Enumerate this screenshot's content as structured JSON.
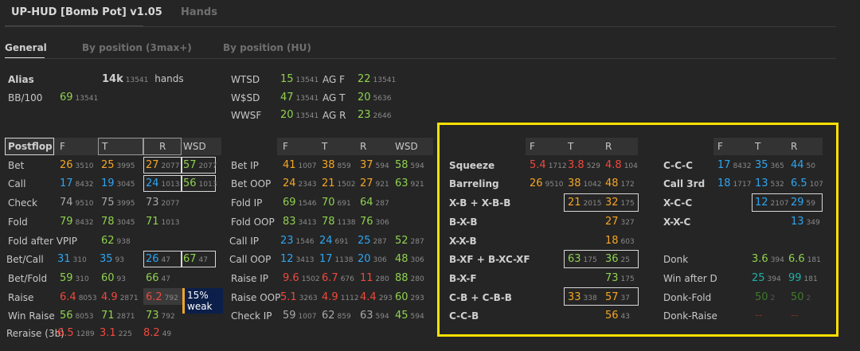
{
  "tabs_top": {
    "active": "UP-HUD [Bomb Pot] v1.05",
    "other": "Hands"
  },
  "tabs_sub": {
    "general": "General",
    "by_pos_3max": "By position (3max+)",
    "by_pos_hu": "By position (HU)"
  },
  "summary": {
    "alias_label": "Alias",
    "hands_val": "14k",
    "hands_n": "13541",
    "hands_label": "hands",
    "bb100_label": "BB/100",
    "bb100_val": "69",
    "bb100_n": "13541",
    "wtsd_label": "WTSD",
    "wtsd_val": "15",
    "wtsd_n": "13541",
    "wssd_label": "W$SD",
    "wssd_val": "47",
    "wssd_n": "13541",
    "wwsf_label": "WWSF",
    "wwsf_val": "20",
    "wwsf_n": "13541",
    "agf_label": "AG F",
    "agf_val": "22",
    "agf_n": "13541",
    "agt_label": "AG T",
    "agt_val": "20",
    "agt_n": "5636",
    "agr_label": "AG R",
    "agr_val": "23",
    "agr_n": "2646"
  },
  "postflop": {
    "title": "Postflop",
    "cols": [
      "F",
      "T",
      "R",
      "WSD"
    ],
    "rows": [
      {
        "label": "Bet",
        "v": [
          [
            "26",
            "3510"
          ],
          [
            "25",
            "3995"
          ],
          [
            "27",
            "2077"
          ],
          [
            "57",
            "2077"
          ]
        ]
      },
      {
        "label": "Call",
        "v": [
          [
            "17",
            "8432"
          ],
          [
            "19",
            "3045"
          ],
          [
            "24",
            "1013"
          ],
          [
            "56",
            "1013"
          ]
        ]
      },
      {
        "label": "Check",
        "v": [
          [
            "74",
            "9510"
          ],
          [
            "75",
            "3995"
          ],
          [
            "73",
            "2077"
          ]
        ]
      },
      {
        "label": "Fold",
        "v": [
          [
            "79",
            "8432"
          ],
          [
            "78",
            "3045"
          ],
          [
            "71",
            "1013"
          ]
        ]
      },
      {
        "label": "Fold after VPIP",
        "v": [
          [
            "62",
            "938"
          ]
        ]
      },
      {
        "label": "Bet/Call",
        "v": [
          [
            "31",
            "310"
          ],
          [
            "35",
            "93"
          ],
          [
            "26",
            "47"
          ],
          [
            "67",
            "47"
          ]
        ]
      },
      {
        "label": "Bet/Fold",
        "v": [
          [
            "59",
            "310"
          ],
          [
            "60",
            "93"
          ],
          [
            "66",
            "47"
          ]
        ]
      },
      {
        "label": "Raise",
        "v": [
          [
            "6.4",
            "8053"
          ],
          [
            "4.9",
            "2871"
          ],
          [
            "6.2",
            "792"
          ]
        ]
      },
      {
        "label": "Win Raise",
        "v": [
          [
            "56",
            "8053"
          ],
          [
            "71",
            "2871"
          ],
          [
            "73",
            "792"
          ]
        ]
      },
      {
        "label": "Reraise (3b)",
        "v": [
          [
            "6.5",
            "1289"
          ],
          [
            "3.1",
            "225"
          ],
          [
            "8.2",
            "49"
          ]
        ]
      }
    ],
    "tooltip": "15% weak"
  },
  "ipoop": {
    "cols": [
      "F",
      "T",
      "R",
      "WSD"
    ],
    "rows": [
      {
        "label": "Bet IP",
        "v": [
          [
            "41",
            "1007"
          ],
          [
            "38",
            "859"
          ],
          [
            "37",
            "594"
          ],
          [
            "58",
            "594"
          ]
        ]
      },
      {
        "label": "Bet OOP",
        "v": [
          [
            "24",
            "2343"
          ],
          [
            "21",
            "1502"
          ],
          [
            "27",
            "921"
          ],
          [
            "63",
            "921"
          ]
        ]
      },
      {
        "label": "Fold IP",
        "v": [
          [
            "69",
            "1546"
          ],
          [
            "70",
            "691"
          ],
          [
            "64",
            "287"
          ]
        ]
      },
      {
        "label": "Fold OOP",
        "v": [
          [
            "83",
            "3413"
          ],
          [
            "78",
            "1138"
          ],
          [
            "76",
            "306"
          ]
        ]
      },
      {
        "label": "Call IP",
        "v": [
          [
            "23",
            "1546"
          ],
          [
            "24",
            "691"
          ],
          [
            "25",
            "287"
          ],
          [
            "52",
            "287"
          ]
        ]
      },
      {
        "label": "Call OOP",
        "v": [
          [
            "12",
            "3413"
          ],
          [
            "17",
            "1138"
          ],
          [
            "20",
            "306"
          ],
          [
            "48",
            "306"
          ]
        ]
      },
      {
        "label": "Raise IP",
        "v": [
          [
            "9.6",
            "1502"
          ],
          [
            "6.7",
            "676"
          ],
          [
            "11",
            "280"
          ],
          [
            "88",
            "280"
          ]
        ]
      },
      {
        "label": "Raise OOP",
        "v": [
          [
            "5.1",
            "3263"
          ],
          [
            "4.9",
            "1112"
          ],
          [
            "4.4",
            "293"
          ],
          [
            "60",
            "293"
          ]
        ]
      },
      {
        "label": "Check IP",
        "v": [
          [
            "59",
            "1007"
          ],
          [
            "62",
            "859"
          ],
          [
            "63",
            "594"
          ],
          [
            "45",
            "594"
          ]
        ]
      }
    ]
  },
  "lines": {
    "cols": [
      "F",
      "T",
      "R"
    ],
    "rows": [
      {
        "label": "Squeeze",
        "v": [
          [
            "5.4",
            "1712"
          ],
          [
            "3.8",
            "529"
          ],
          [
            "4.8",
            "104"
          ]
        ]
      },
      {
        "label": "Barreling",
        "v": [
          [
            "26",
            "9510"
          ],
          [
            "38",
            "1042"
          ],
          [
            "48",
            "172"
          ]
        ]
      },
      {
        "label": "X-B + X-B-B",
        "v": [
          [
            "21",
            "2015"
          ],
          [
            "32",
            "175"
          ]
        ]
      },
      {
        "label": "B-X-B",
        "v": [
          [
            "27",
            "327"
          ]
        ]
      },
      {
        "label": "X-X-B",
        "v": [
          [
            "18",
            "603"
          ]
        ]
      },
      {
        "label": "B-XF + B-XC-XF",
        "v": [
          [
            "63",
            "175"
          ],
          [
            "36",
            "25"
          ]
        ]
      },
      {
        "label": "B-X-F",
        "v": [
          [
            "73",
            "175"
          ]
        ]
      },
      {
        "label": "C-B + C-B-B",
        "v": [
          [
            "33",
            "338"
          ],
          [
            "57",
            "37"
          ]
        ]
      },
      {
        "label": "C-C-B",
        "v": [
          [
            "56",
            "43"
          ]
        ]
      }
    ]
  },
  "lines2": {
    "cols": [
      "F",
      "T",
      "R"
    ],
    "rows": [
      {
        "label": "C-C-C",
        "v": [
          [
            "17",
            "8432"
          ],
          [
            "35",
            "365"
          ],
          [
            "44",
            "50"
          ]
        ]
      },
      {
        "label": "Call 3rd",
        "v": [
          [
            "18",
            "1717"
          ],
          [
            "13",
            "532"
          ],
          [
            "6.5",
            "107"
          ]
        ]
      },
      {
        "label": "X-C-C",
        "v": [
          [
            "12",
            "2107"
          ],
          [
            "29",
            "59"
          ]
        ]
      },
      {
        "label": "X-X-C",
        "v": [
          [
            "13",
            "349"
          ]
        ]
      },
      {
        "label": "Donk",
        "v": [
          [
            "3.6",
            "394"
          ],
          [
            "6.6",
            "181"
          ]
        ]
      },
      {
        "label": "Win after D",
        "v": [
          [
            "25",
            "394"
          ],
          [
            "99",
            "181"
          ]
        ]
      },
      {
        "label": "Donk-Fold",
        "v": [
          [
            "50",
            "2"
          ],
          [
            "50",
            "2"
          ]
        ]
      },
      {
        "label": "Donk-Raise",
        "v": [
          [
            "--",
            ""
          ],
          [
            "--",
            ""
          ]
        ]
      }
    ]
  },
  "colors": {
    "bg": "#252525",
    "highlight": "#ffe000",
    "green": "#8fd14f",
    "blue": "#2ea5f0",
    "orange": "#f5a623",
    "red": "#f0483c"
  }
}
